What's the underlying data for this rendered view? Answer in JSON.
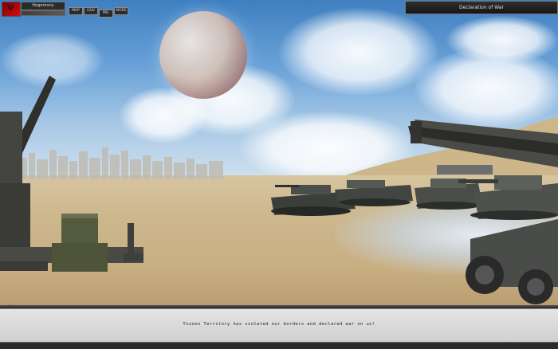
{
  "hud": {
    "nation_name": "Hegemony",
    "buttons": [
      {
        "id": "main",
        "label": "MAP"
      },
      {
        "id": "gov",
        "label": "GOV"
      },
      {
        "id": "mil",
        "label": "MIL"
      },
      {
        "id": "more",
        "label": "MORE"
      }
    ],
    "event_title": "Declaration of War"
  },
  "message": {
    "text": "Tozono Territory has violated our borders and declared war on us!"
  },
  "colors": {
    "flag": "#c41010",
    "panel": "#1f1f1f",
    "message_bar": "#d8d8d8"
  },
  "icons": {
    "flag_mark": "Ψ"
  }
}
